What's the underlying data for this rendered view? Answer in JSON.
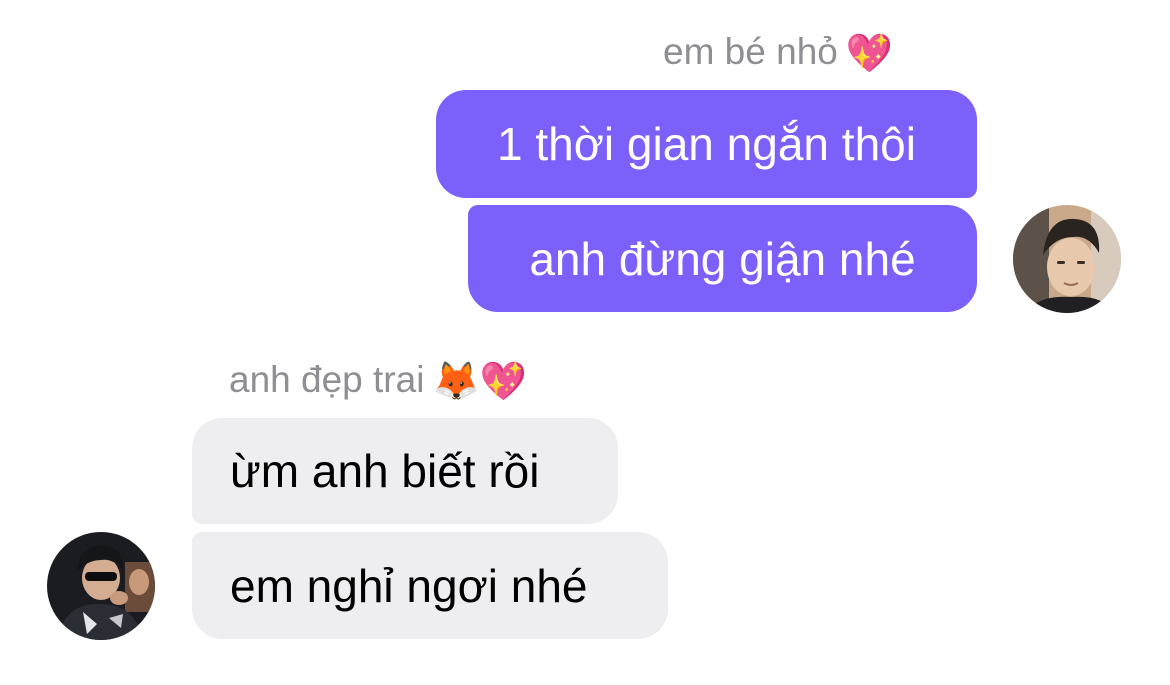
{
  "chat": {
    "outgoing_sender": {
      "name": "em bé nhỏ",
      "emoji": "💖",
      "emoji_icons": [
        "sparkling-heart-icon"
      ]
    },
    "outgoing_messages": [
      "1 thời gian ngắn thôi",
      "anh đừng giận nhé"
    ],
    "incoming_sender": {
      "name": "anh đẹp trai",
      "emoji": "🦊💖",
      "emoji_icons": [
        "fox-icon",
        "sparkling-heart-icon"
      ]
    },
    "incoming_messages": [
      "ừm anh biết rồi",
      "em nghỉ ngơi nhé"
    ]
  },
  "colors": {
    "outgoing_bubble": "#7b61fa",
    "incoming_bubble": "#eeeef0",
    "sender_name": "#8e8e93"
  }
}
